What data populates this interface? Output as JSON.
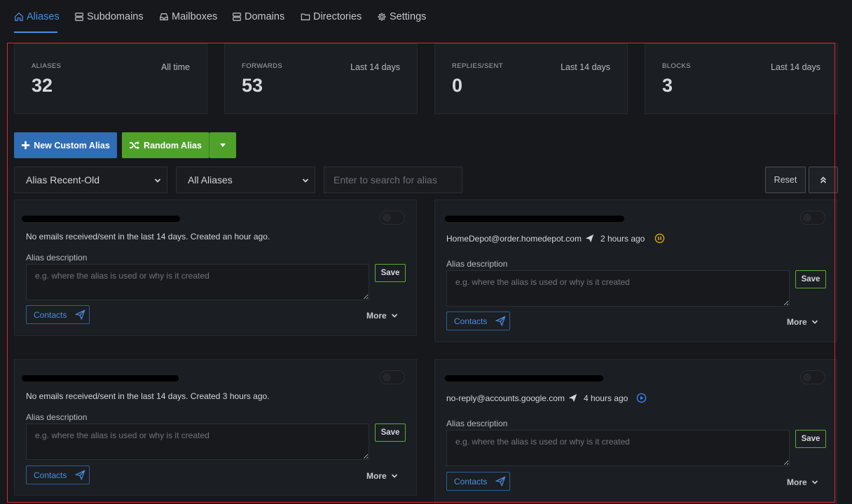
{
  "nav": {
    "items": [
      {
        "label": "Aliases",
        "icon": "home-icon"
      },
      {
        "label": "Subdomains",
        "icon": "server-icon"
      },
      {
        "label": "Mailboxes",
        "icon": "inbox-icon"
      },
      {
        "label": "Domains",
        "icon": "server-icon"
      },
      {
        "label": "Directories",
        "icon": "folder-icon"
      },
      {
        "label": "Settings",
        "icon": "gear-icon"
      }
    ],
    "active": "Aliases",
    "accent": "#4a90e2"
  },
  "stats": [
    {
      "label": "ALIASES",
      "period": "All time",
      "value": "32"
    },
    {
      "label": "FORWARDS",
      "period": "Last 14 days",
      "value": "53"
    },
    {
      "label": "REPLIES/SENT",
      "period": "Last 14 days",
      "value": "0"
    },
    {
      "label": "BLOCKS",
      "period": "Last 14 days",
      "value": "3"
    }
  ],
  "actions": {
    "new_custom_alias": "New Custom Alias",
    "random_alias": "Random Alias"
  },
  "filters": {
    "sort_selected": "Alias Recent-Old",
    "filter_selected": "All Aliases",
    "search_placeholder": "Enter to search for alias",
    "reset_label": "Reset"
  },
  "aliases": [
    {
      "activity": "No emails received/sent in the last 14 days. Created an hour ago.",
      "desc_label": "Alias description",
      "desc_placeholder": "e.g. where the alias is used or why is it created",
      "save_label": "Save",
      "contacts_label": "Contacts",
      "more_label": "More"
    },
    {
      "contact": "HomeDepot@order.homedepot.com",
      "time": "2 hours ago",
      "status_icon": "pause-circle-icon",
      "status_color": "#e0a800",
      "desc_label": "Alias description",
      "desc_placeholder": "e.g. where the alias is used or why is it created",
      "save_label": "Save",
      "contacts_label": "Contacts",
      "more_label": "More"
    },
    {
      "activity": "No emails received/sent in the last 14 days. Created 3 hours ago.",
      "desc_label": "Alias description",
      "desc_placeholder": "e.g. where the alias is used or why is it created",
      "save_label": "Save",
      "contacts_label": "Contacts",
      "more_label": "More"
    },
    {
      "contact": "no-reply@accounts.google.com",
      "time": "4 hours ago",
      "status_icon": "play-circle-icon",
      "status_color": "#3b82f6",
      "desc_label": "Alias description",
      "desc_placeholder": "e.g. where the alias is used or why is it created",
      "save_label": "Save",
      "contacts_label": "Contacts",
      "more_label": "More"
    }
  ],
  "highlight_color": "#e0262a"
}
